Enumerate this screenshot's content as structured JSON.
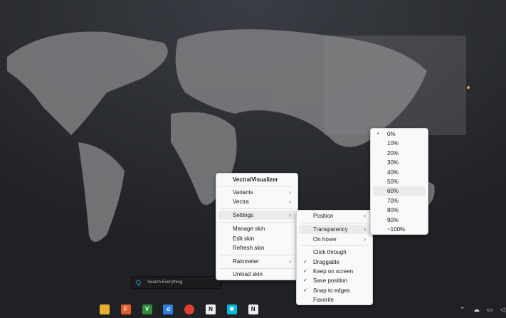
{
  "main_menu": {
    "title": "Vectra\\Visualizer",
    "items": [
      "Variants",
      "Vectra",
      "Settings",
      "Manage skin",
      "Edit skin",
      "Refresh skin",
      "Rainmeter",
      "Unload skin"
    ]
  },
  "settings_menu": {
    "items": [
      "Position",
      "Transparency",
      "On hover",
      "Click through",
      "Draggable",
      "Keep on screen",
      "Save position",
      "Snap to edges",
      "Favorite"
    ],
    "checked": [
      "Draggable",
      "Keep on screen",
      "Save position",
      "Snap to edges"
    ]
  },
  "transparency_menu": {
    "items": [
      "0%",
      "10%",
      "20%",
      "30%",
      "40%",
      "50%",
      "60%",
      "70%",
      "80%",
      "90%",
      "~100%"
    ],
    "selected": "0%",
    "highlighted": "60%"
  },
  "search": {
    "placeholder": "Search Everything"
  },
  "taskbar": {
    "icons": [
      "file-explorer-icon",
      "foxit-icon",
      "vim-icon",
      "jd-icon",
      "chrome-icon",
      "notion-icon",
      "rainmeter-icon",
      "notion-icon-2"
    ],
    "tray": [
      "chevron-up-icon",
      "onedrive-icon",
      "network-icon",
      "volume-icon"
    ]
  },
  "glyphs": {
    "arrow": "›",
    "check": "✓",
    "dot": "•",
    "search": "Q"
  }
}
